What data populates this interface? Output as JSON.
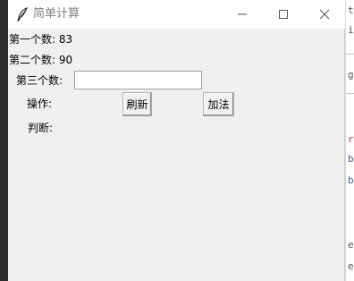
{
  "window": {
    "title": "简单计算",
    "icon": "feather-icon",
    "controls": [
      "minimize-icon",
      "maximize-icon",
      "close-icon"
    ]
  },
  "labels": {
    "first": "第一个数: 83",
    "second": "第二个数: 90",
    "third": "第三个数:",
    "operation": "操作:",
    "judgment": "判断:"
  },
  "input": {
    "value": "",
    "placeholder": ""
  },
  "buttons": {
    "refresh": "刷新",
    "add": "加法"
  },
  "background_editor": {
    "fragments": [
      "t",
      "i",
      "g",
      "r",
      "b",
      "b",
      "e",
      "e"
    ]
  }
}
